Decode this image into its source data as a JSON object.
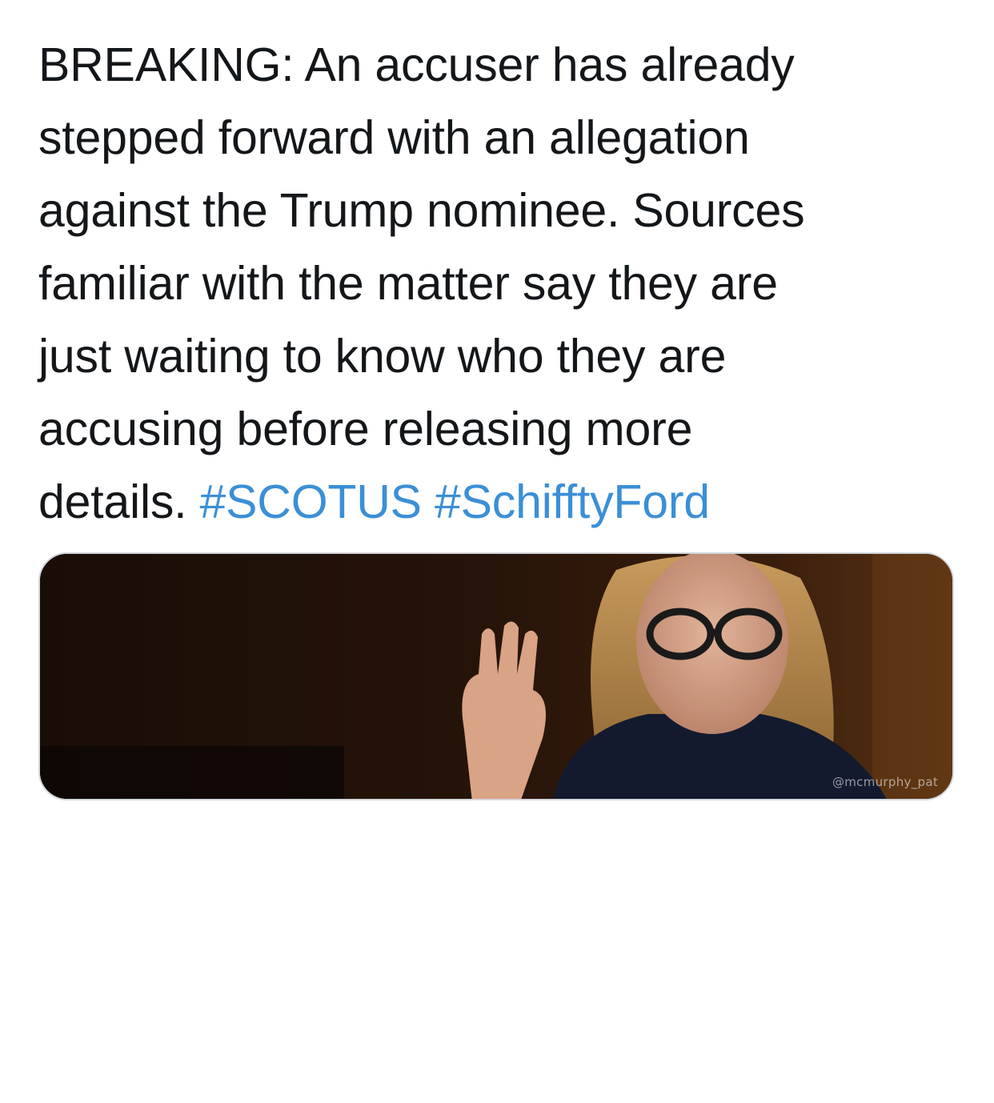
{
  "tweet": {
    "lines": [
      "BREAKING: An accuser has already",
      "stepped forward with an allegation",
      "against the Trump nominee. Sources",
      "familiar with the matter say they are",
      "just waiting to know who they are",
      "accusing before releasing more"
    ],
    "last_line_text": "details.",
    "hashtags": [
      "#SCOTUS",
      "#SchifftyFord"
    ],
    "hashtag_color": "#3b8fd6",
    "text_color": "#14171a"
  },
  "media": {
    "watermark": "@mcmurphy_pat",
    "subject": "person-raising-right-hand-photo"
  }
}
